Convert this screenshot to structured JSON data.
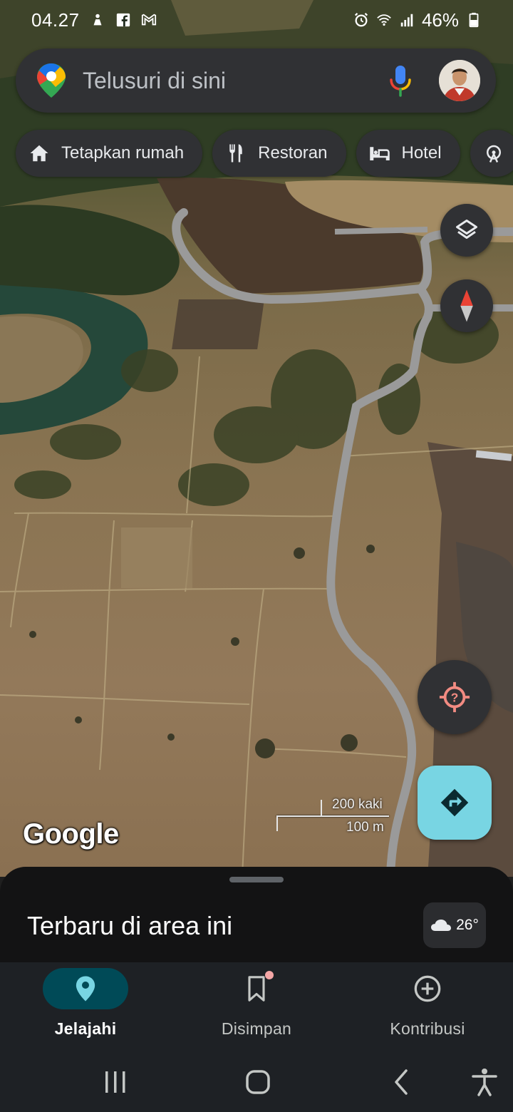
{
  "status_bar": {
    "time": "04.27",
    "battery": "46%",
    "icons": [
      "person-notification-icon",
      "facebook-icon",
      "gmail-icon",
      "alarm-icon",
      "wifi-icon",
      "signal-icon",
      "battery-icon"
    ]
  },
  "search": {
    "placeholder": "Telusuri di sini",
    "icons": [
      "maps-pin-icon",
      "mic-icon",
      "avatar"
    ]
  },
  "chips": [
    {
      "label": "Tetapkan rumah",
      "icon": "home-icon"
    },
    {
      "label": "Restoran",
      "icon": "restaurant-icon"
    },
    {
      "label": "Hotel",
      "icon": "hotel-icon"
    },
    {
      "label": "",
      "icon": "attractions-icon"
    }
  ],
  "map": {
    "logo": "Google",
    "scale_top": "200 kaki",
    "scale_bottom": "100 m",
    "buttons": [
      "layers-icon",
      "compass-icon",
      "my-location-icon",
      "directions-icon"
    ]
  },
  "sheet": {
    "title": "Terbaru di area ini",
    "weather_temp": "26°",
    "weather_icon": "cloud-icon"
  },
  "nav": [
    {
      "label": "Jelajahi",
      "icon": "explore-pin-icon",
      "active": true
    },
    {
      "label": "Disimpan",
      "icon": "bookmark-icon",
      "active": false
    },
    {
      "label": "Kontribusi",
      "icon": "add-circle-icon",
      "active": false
    }
  ],
  "system_nav": [
    "recents-icon",
    "home-icon",
    "back-icon",
    "accessibility-icon"
  ],
  "colors": {
    "surface": "#303134",
    "nav_bg": "#1e2125",
    "sheet_bg": "#131314",
    "active_pill": "#004a57",
    "directions": "#78d5e3",
    "locate_red": "#f28b82"
  }
}
